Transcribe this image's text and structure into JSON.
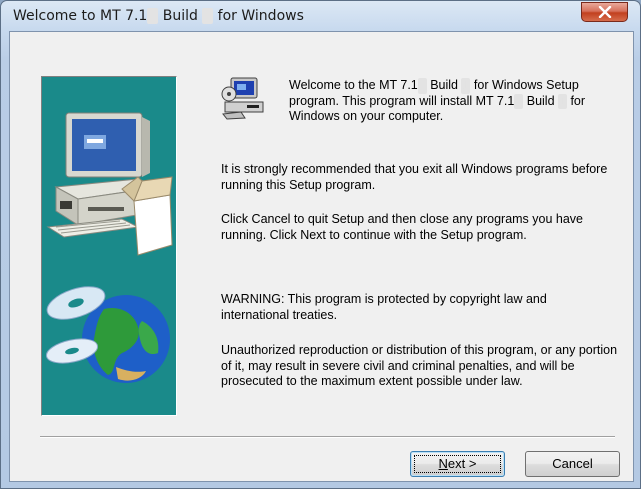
{
  "window": {
    "title_parts": [
      "Welcome to MT 7.1",
      "",
      " Build ",
      "",
      " for Windows"
    ]
  },
  "intro": {
    "line1_parts": [
      "Welcome to the MT 7.1",
      "",
      " Build ",
      "",
      " for Windows Setup"
    ],
    "line2_parts": [
      "program.  This program will install MT 7.1",
      "",
      " Build ",
      "",
      " for"
    ],
    "line3": "Windows on your computer."
  },
  "paragraphs": {
    "recommend": "It is strongly recommended that you exit all Windows programs before running this Setup program.",
    "cancel_info": "Click Cancel to quit Setup and then close any programs you have running.  Click Next to continue with the Setup program.",
    "warning": "WARNING: This program is protected by copyright law and international treaties.",
    "unauthorized": "Unauthorized reproduction or distribution of this program, or any portion of it, may result in severe civil and criminal penalties, and will be prosecuted to the maximum extent possible under law."
  },
  "buttons": {
    "next_label_accel": "N",
    "next_label_rest": "ext >",
    "cancel_label": "Cancel"
  },
  "icons": {
    "close": "close-icon",
    "setup": "setup-computer-icon",
    "art": "computer-globe-cd-illustration"
  },
  "colors": {
    "art_background": "#1a8a8a",
    "close_button": "#c2401f",
    "dialog_background": "#f0f0f0"
  }
}
